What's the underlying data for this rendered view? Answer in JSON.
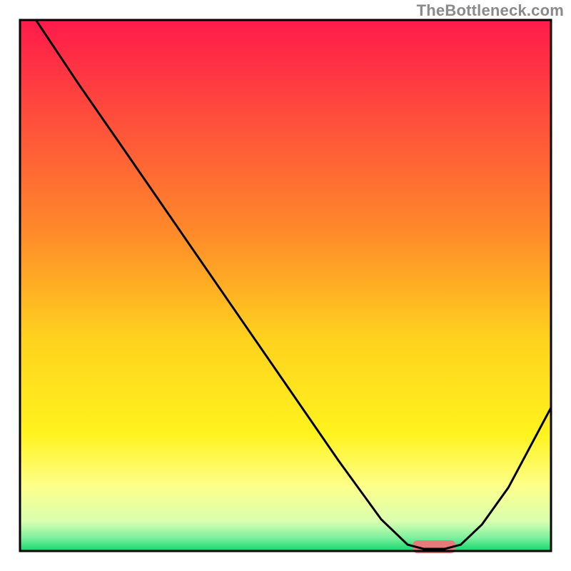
{
  "attribution": "TheBottleneck.com",
  "chart_data": {
    "type": "line",
    "title": "",
    "xlabel": "",
    "ylabel": "",
    "xlim": [
      0,
      100
    ],
    "ylim": [
      0,
      100
    ],
    "grid": false,
    "legend": false,
    "background_gradient": {
      "stops": [
        {
          "offset": 0.0,
          "color": "#ff1a4b"
        },
        {
          "offset": 0.4,
          "color": "#ff8a2a"
        },
        {
          "offset": 0.6,
          "color": "#ffd21e"
        },
        {
          "offset": 0.78,
          "color": "#fff31e"
        },
        {
          "offset": 0.88,
          "color": "#fdff8c"
        },
        {
          "offset": 0.945,
          "color": "#d8ffb0"
        },
        {
          "offset": 0.975,
          "color": "#7df09e"
        },
        {
          "offset": 1.0,
          "color": "#13d66b"
        }
      ]
    },
    "series": [
      {
        "name": "bottleneck-curve",
        "color": "#000000",
        "x": [
          3,
          11,
          20,
          30,
          40,
          50,
          60,
          68,
          73,
          76,
          80,
          83,
          87,
          92,
          100
        ],
        "y": [
          100,
          88,
          75,
          60.5,
          46,
          31.5,
          17,
          6,
          1.2,
          0.4,
          0.4,
          1.2,
          5,
          12,
          27
        ]
      }
    ],
    "highlight_segment": {
      "name": "optimal-marker",
      "color": "#e77b7b",
      "x_start": 74,
      "x_end": 82,
      "y": 0.8,
      "thickness": 2.4
    },
    "frame_color": "#000000"
  }
}
